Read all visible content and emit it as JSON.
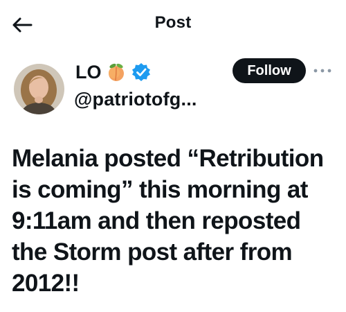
{
  "header": {
    "title": "Post",
    "back_icon": "arrow-left-icon"
  },
  "author": {
    "name": "LO",
    "emoji": "peach-icon",
    "badge_icon": "verified-badge-icon",
    "badge_color": "#1d9bf0",
    "handle": "@patriotofg..."
  },
  "actions": {
    "follow_label": "Follow",
    "more_icon": "more-horizontal-icon"
  },
  "post": {
    "text": "Melania posted “Retribution is coming” this morning at 9:11am and then reposted the Storm post after from 2012!!"
  }
}
